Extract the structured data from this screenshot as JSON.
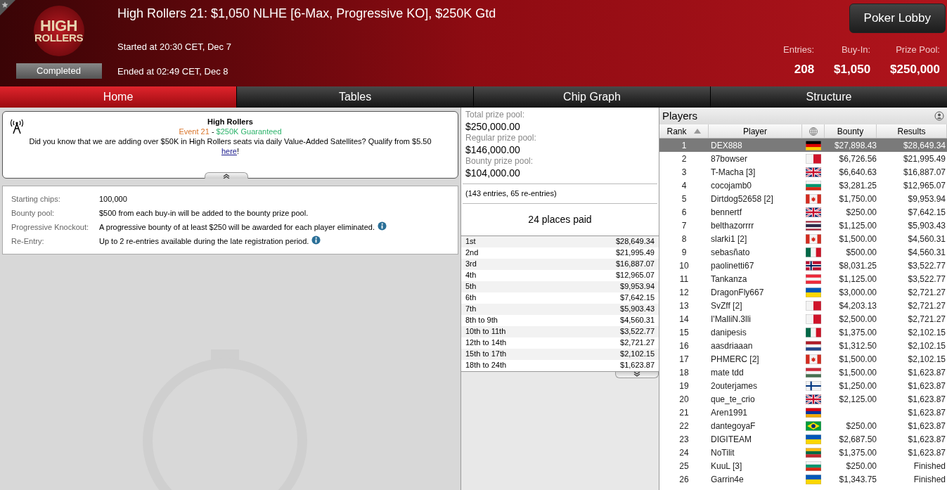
{
  "header": {
    "logo": {
      "line1": "HIGH",
      "line2": "ROLLERS"
    },
    "status": "Completed",
    "title": "High Rollers 21: $1,050 NLHE [6-Max, Progressive KO], $250K Gtd",
    "started": "Started at 20:30 CET, Dec 7",
    "ended": "Ended at 02:49 CET, Dec 8",
    "lobby_button": "Poker Lobby",
    "stats": [
      {
        "label": "Entries:",
        "value": "208"
      },
      {
        "label": "Buy-In:",
        "value": "$1,050"
      },
      {
        "label": "Prize Pool:",
        "value": "$250,000"
      }
    ]
  },
  "tabs": [
    {
      "label": "Home",
      "selected": true
    },
    {
      "label": "Tables",
      "selected": false
    },
    {
      "label": "Chip Graph",
      "selected": false
    },
    {
      "label": "Structure",
      "selected": false
    }
  ],
  "news": {
    "title": "High Rollers",
    "event": "Event 21",
    "separator": " - ",
    "guarantee": "$250K Guaranteed",
    "text": "Did you know that we are adding over $50K in High Rollers seats via daily Value-Added Satellites? Qualify from $5.50",
    "link": "here",
    "after": "!"
  },
  "info": [
    {
      "label": "Starting chips:",
      "value": "100,000",
      "info": false
    },
    {
      "label": "Bounty pool:",
      "value": "$500 from each buy-in will be added to the bounty prize pool.",
      "info": false
    },
    {
      "label": "Progressive Knockout:",
      "value": "A progressive bounty of at least $250 will be awarded for each player eliminated.",
      "info": true
    },
    {
      "label": "Re-Entry:",
      "value": "Up to 2 re-entries available during the late registration period.",
      "info": true
    }
  ],
  "prize_pools": [
    {
      "label": "Total prize pool:",
      "value": "$250,000.00"
    },
    {
      "label": "Regular prize pool:",
      "value": "$146,000.00"
    },
    {
      "label": "Bounty prize pool:",
      "value": "$104,000.00"
    }
  ],
  "entries_note": "(143 entries, 65 re-entries)",
  "places_paid": "24 places paid",
  "payouts": [
    {
      "place": "1st",
      "amount": "$28,649.34"
    },
    {
      "place": "2nd",
      "amount": "$21,995.49"
    },
    {
      "place": "3rd",
      "amount": "$16,887.07"
    },
    {
      "place": "4th",
      "amount": "$12,965.07"
    },
    {
      "place": "5th",
      "amount": "$9,953.94"
    },
    {
      "place": "6th",
      "amount": "$7,642.15"
    },
    {
      "place": "7th",
      "amount": "$5,903.43"
    },
    {
      "place": "8th to 9th",
      "amount": "$4,560.31"
    },
    {
      "place": "10th to 11th",
      "amount": "$3,522.77"
    },
    {
      "place": "12th to 14th",
      "amount": "$2,721.27"
    },
    {
      "place": "15th to 17th",
      "amount": "$2,102.15"
    },
    {
      "place": "18th to 24th",
      "amount": "$1,623.87"
    }
  ],
  "players": {
    "title": "Players",
    "columns": [
      {
        "label": "Rank",
        "sorted": true
      },
      {
        "label": "Player",
        "sorted": false
      },
      {
        "label": "Bounty",
        "sorted": false
      },
      {
        "label": "Results",
        "sorted": false
      }
    ],
    "rows": [
      {
        "rank": "1",
        "name": "DEX888",
        "kind": "germany",
        "bounty": "$27,898.43",
        "result": "$28,649.34",
        "selected": true
      },
      {
        "rank": "2",
        "name": "87bowser",
        "kind": "malta",
        "bounty": "$6,726.56",
        "result": "$21,995.49",
        "selected": false
      },
      {
        "rank": "3",
        "name": "T-Macha [3]",
        "kind": "uk",
        "bounty": "$6,640.63",
        "result": "$16,887.07",
        "selected": false
      },
      {
        "rank": "4",
        "name": "cocojamb0",
        "kind": "bulgaria",
        "bounty": "$3,281.25",
        "result": "$12,965.07",
        "selected": false
      },
      {
        "rank": "5",
        "name": "Dirtdog52658 [2]",
        "kind": "canada",
        "bounty": "$1,750.00",
        "result": "$9,953.94",
        "selected": false
      },
      {
        "rank": "6",
        "name": "bennertf",
        "kind": "uk",
        "bounty": "$250.00",
        "result": "$7,642.15",
        "selected": false
      },
      {
        "rank": "7",
        "name": "belthazorrrr",
        "kind": "thailand",
        "bounty": "$1,125.00",
        "result": "$5,903.43",
        "selected": false
      },
      {
        "rank": "8",
        "name": "slarki1 [2]",
        "kind": "canada",
        "bounty": "$1,500.00",
        "result": "$4,560.31",
        "selected": false
      },
      {
        "rank": "9",
        "name": "sebasñato",
        "kind": "mexico",
        "bounty": "$500.00",
        "result": "$4,560.31",
        "selected": false
      },
      {
        "rank": "10",
        "name": "paolinetti67",
        "kind": "norway",
        "bounty": "$8,031.25",
        "result": "$3,522.77",
        "selected": false
      },
      {
        "rank": "11",
        "name": "Tankanza",
        "kind": "austria",
        "bounty": "$1,125.00",
        "result": "$3,522.77",
        "selected": false
      },
      {
        "rank": "12",
        "name": "DragonFly667",
        "kind": "ukraine",
        "bounty": "$3,000.00",
        "result": "$2,721.27",
        "selected": false
      },
      {
        "rank": "13",
        "name": "SvZff [2]",
        "kind": "malta",
        "bounty": "$4,203.13",
        "result": "$2,721.27",
        "selected": false
      },
      {
        "rank": "14",
        "name": "I'MalliN.3lli",
        "kind": "malta",
        "bounty": "$2,500.00",
        "result": "$2,721.27",
        "selected": false
      },
      {
        "rank": "15",
        "name": "danipesis",
        "kind": "mexico",
        "bounty": "$1,375.00",
        "result": "$2,102.15",
        "selected": false
      },
      {
        "rank": "16",
        "name": "aasdriaaan",
        "kind": "netherlands",
        "bounty": "$1,312.50",
        "result": "$2,102.15",
        "selected": false
      },
      {
        "rank": "17",
        "name": "PHMERC [2]",
        "kind": "canada",
        "bounty": "$1,500.00",
        "result": "$2,102.15",
        "selected": false
      },
      {
        "rank": "18",
        "name": "mate tdd",
        "kind": "hungary",
        "bounty": "$1,500.00",
        "result": "$1,623.87",
        "selected": false
      },
      {
        "rank": "19",
        "name": "2outerjames",
        "kind": "finland",
        "bounty": "$1,250.00",
        "result": "$1,623.87",
        "selected": false
      },
      {
        "rank": "20",
        "name": "que_te_crio",
        "kind": "uk",
        "bounty": "$2,125.00",
        "result": "$1,623.87",
        "selected": false
      },
      {
        "rank": "21",
        "name": "Aren1991",
        "kind": "armenia",
        "result": "$1,623.87",
        "selected": false
      },
      {
        "rank": "22",
        "name": "dantegoyaF",
        "kind": "brazil",
        "bounty": "$250.00",
        "result": "$1,623.87",
        "selected": false
      },
      {
        "rank": "23",
        "name": "DIGITEAM",
        "kind": "ukraine",
        "bounty": "$2,687.50",
        "result": "$1,623.87",
        "selected": false
      },
      {
        "rank": "24",
        "name": "NoTilit",
        "kind": "lithuania",
        "bounty": "$1,375.00",
        "result": "$1,623.87",
        "selected": false
      },
      {
        "rank": "25",
        "name": "KuuL [3]",
        "kind": "bulgaria",
        "bounty": "$250.00",
        "result": "Finished",
        "selected": false
      },
      {
        "rank": "26",
        "name": "Garrin4e",
        "kind": "ukraine",
        "bounty": "$1,343.75",
        "result": "Finished",
        "selected": false
      }
    ]
  }
}
